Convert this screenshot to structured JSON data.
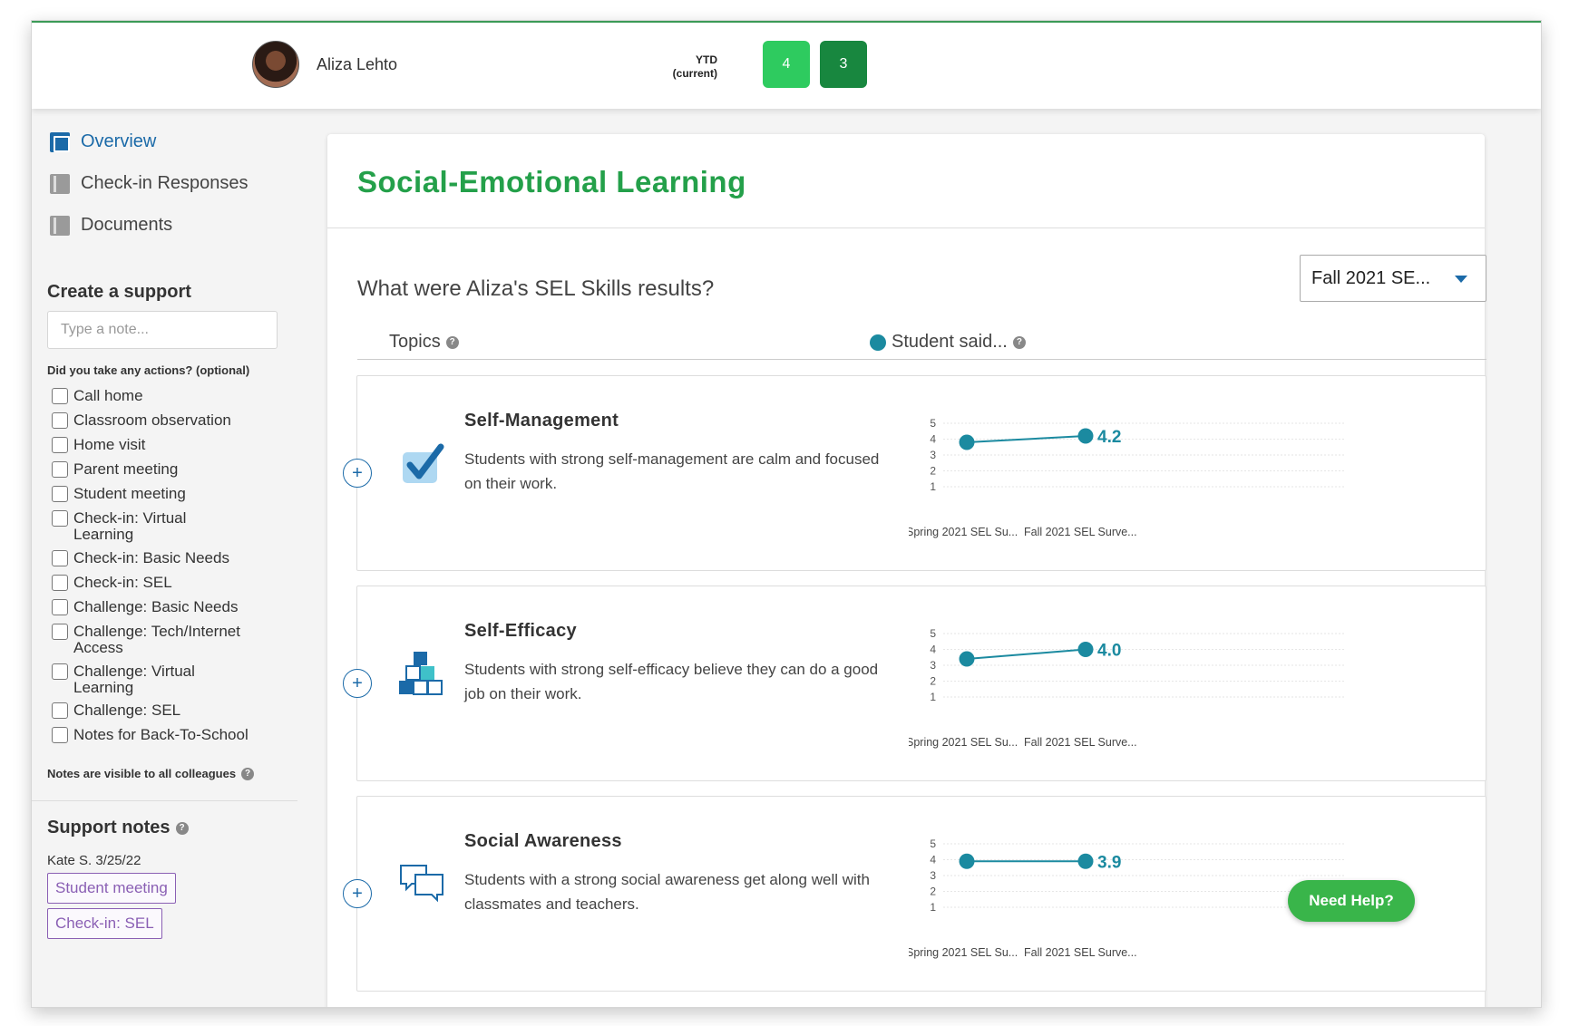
{
  "header": {
    "student_name": "Aliza Lehto",
    "ytd_label_1": "YTD",
    "ytd_label_2": "(current)",
    "ytd_value_a": "4",
    "ytd_value_b": "3"
  },
  "sidebar": {
    "nav": [
      {
        "label": "Overview",
        "icon": "overview-icon",
        "active": true
      },
      {
        "label": "Check-in Responses",
        "icon": "book-icon",
        "active": false
      },
      {
        "label": "Documents",
        "icon": "book-icon",
        "active": false
      }
    ],
    "create_support_title": "Create a support",
    "note_placeholder": "Type a note...",
    "actions_question": "Did you take any actions? (optional)",
    "actions": [
      "Call home",
      "Classroom observation",
      "Home visit",
      "Parent meeting",
      "Student meeting",
      "Check-in: Virtual Learning",
      "Check-in: Basic Needs",
      "Check-in: SEL",
      "Challenge: Basic Needs",
      "Challenge: Tech/Internet Access",
      "Challenge: Virtual Learning",
      "Challenge: SEL",
      "Notes for Back-To-School"
    ],
    "visibility_note": "Notes are visible to all colleagues",
    "support_notes_title": "Support notes",
    "support_author": "Kate S. 3/25/22",
    "support_tags": [
      "Student meeting",
      "Check-in: SEL"
    ]
  },
  "main": {
    "title": "Social-Emotional Learning",
    "question": "What were Aliza's SEL Skills results?",
    "survey_select": "Fall 2021 SE...",
    "col_topics": "Topics",
    "col_student": "Student said...",
    "help_button": "Need Help?"
  },
  "topics": [
    {
      "title": "Self-Management",
      "desc": "Students with strong self-management are calm and focused on their work.",
      "icon": "checkbox-check-icon"
    },
    {
      "title": "Self-Efficacy",
      "desc": "Students with strong self-efficacy believe they can do a good job on their work.",
      "icon": "stacked-blocks-icon"
    },
    {
      "title": "Social Awareness",
      "desc": "Students with a strong social awareness get along well with classmates and teachers.",
      "icon": "chat-bubbles-icon"
    }
  ],
  "chart_data": [
    {
      "type": "line",
      "title": "Self-Management",
      "categories": [
        "Spring 2021 SEL Su...",
        "Fall 2021 SEL Surve..."
      ],
      "series": [
        {
          "values": [
            3.8,
            4.2
          ]
        }
      ],
      "ylim": [
        1,
        5
      ],
      "yticks": [
        "1",
        "2",
        "3",
        "4",
        "5"
      ],
      "value_label": "4.2",
      "color": "#1b8aa0"
    },
    {
      "type": "line",
      "title": "Self-Efficacy",
      "categories": [
        "Spring 2021 SEL Su...",
        "Fall 2021 SEL Surve..."
      ],
      "series": [
        {
          "values": [
            3.4,
            4.0
          ]
        }
      ],
      "ylim": [
        1,
        5
      ],
      "yticks": [
        "1",
        "2",
        "3",
        "4",
        "5"
      ],
      "value_label": "4.0",
      "color": "#1b8aa0"
    },
    {
      "type": "line",
      "title": "Social Awareness",
      "categories": [
        "Spring 2021 SEL Su...",
        "Fall 2021 SEL Surve..."
      ],
      "series": [
        {
          "values": [
            3.9,
            3.9
          ]
        }
      ],
      "ylim": [
        1,
        5
      ],
      "yticks": [
        "1",
        "2",
        "3",
        "4",
        "5"
      ],
      "value_label": "3.9",
      "color": "#1b8aa0"
    }
  ],
  "colors": {
    "accent_green": "#24a04a",
    "link_blue": "#1b6aa8",
    "tag_purple": "#8a5fb4",
    "chart_teal": "#1b8aa0"
  }
}
